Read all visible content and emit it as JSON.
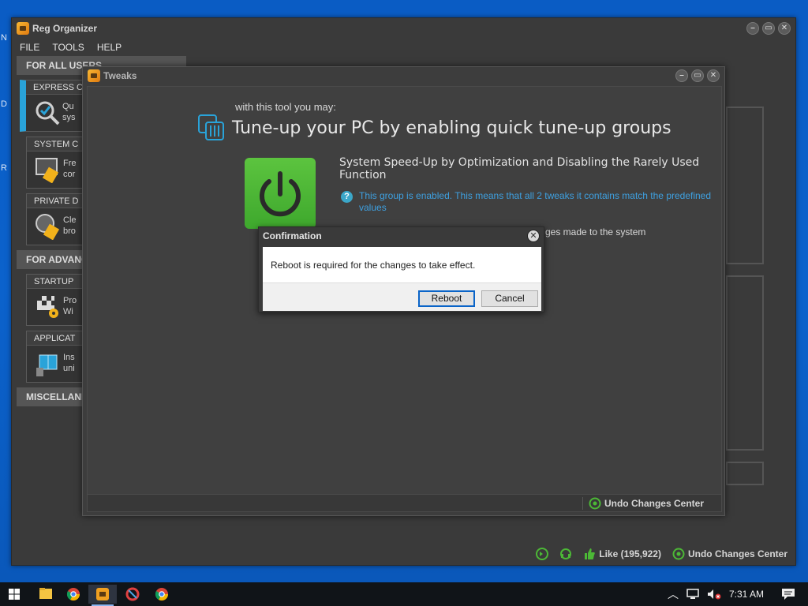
{
  "desktop": {
    "glyphs": [
      "N",
      "D",
      "R"
    ]
  },
  "main_window": {
    "title": "Reg Organizer",
    "menu": [
      "FILE",
      "TOOLS",
      "HELP"
    ],
    "sidebar": {
      "for_all_users": "FOR ALL USERS",
      "for_advanced": "FOR ADVANC",
      "miscellaneous": "MISCELLANE",
      "cards": [
        {
          "title": "EXPRESS C",
          "text1": "Qu",
          "text2": "sys"
        },
        {
          "title": "SYSTEM C",
          "text1": "Fre",
          "text2": "cor"
        },
        {
          "title": "PRIVATE D",
          "text1": "Cle",
          "text2": "bro"
        },
        {
          "title": "STARTUP",
          "text1": "Pro",
          "text2": "Wi"
        },
        {
          "title": "APPLICAT",
          "text1": "Ins",
          "text2": "uni"
        }
      ]
    },
    "status": {
      "like": "Like (195,922)",
      "undo": "Undo Changes Center"
    }
  },
  "tweaks_window": {
    "title": "Tweaks",
    "subtitle": "with this tool you may:",
    "headline": "Tune-up your PC by enabling quick tune-up groups",
    "group_title": "System Speed-Up by Optimization and Disabling the Rarely Used Function",
    "enabled_note": "This group is enabled. This means that all 2 tweaks it contains match the predefined values",
    "changes_note": "ges made to the system",
    "footer_undo": "Undo Changes Center"
  },
  "dialog": {
    "title": "Confirmation",
    "message": "Reboot is required for the changes to take effect.",
    "reboot_label": "Reboot",
    "cancel_label": "Cancel"
  },
  "taskbar": {
    "clock": "7:31 AM"
  },
  "colors": {
    "accent_blue": "#29a3d9",
    "power_green": "#4cb836",
    "link_blue": "#3ea0e0"
  }
}
